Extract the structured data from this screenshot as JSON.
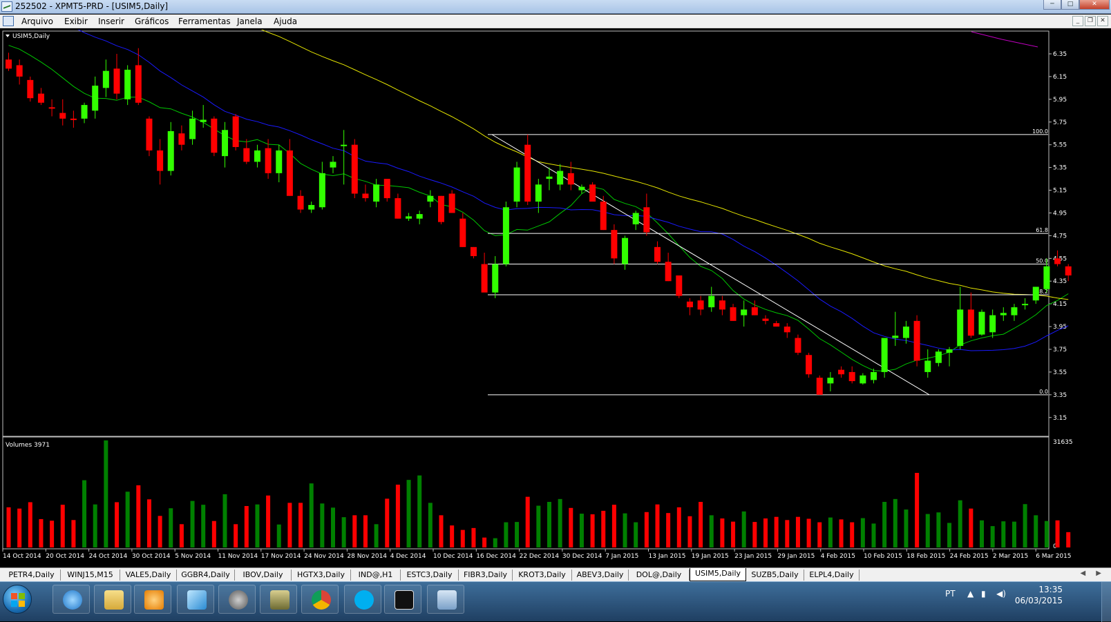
{
  "window": {
    "title": "252502 - XPMT5-PRD - [USIM5,Daily]",
    "btn_min": "─",
    "btn_max": "□",
    "btn_close": "✕"
  },
  "menu": {
    "items": [
      "Arquivo",
      "Exibir",
      "Inserir",
      "Gráficos",
      "Ferramentas",
      "Janela",
      "Ajuda"
    ],
    "mdi_min": "_",
    "mdi_restore": "❐",
    "mdi_close": "✕"
  },
  "chart": {
    "symbol_label": "USIM5,Daily",
    "volume_label": "Volumes 3971",
    "volume_max_label": "31635",
    "volume_min_label": "0",
    "price_ticks": [
      "6.35",
      "6.15",
      "5.95",
      "5.75",
      "5.55",
      "5.35",
      "5.15",
      "4.95",
      "4.75",
      "4.55",
      "4.35",
      "4.15",
      "3.95",
      "3.75",
      "3.55",
      "3.35",
      "3.15"
    ],
    "date_labels": [
      "14 Oct 2014",
      "20 Oct 2014",
      "24 Oct 2014",
      "30 Oct 2014",
      "5 Nov 2014",
      "11 Nov 2014",
      "17 Nov 2014",
      "24 Nov 2014",
      "28 Nov 2014",
      "4 Dec 2014",
      "10 Dec 2014",
      "16 Dec 2014",
      "22 Dec 2014",
      "30 Dec 2014",
      "7 Jan 2015",
      "13 Jan 2015",
      "19 Jan 2015",
      "23 Jan 2015",
      "29 Jan 2015",
      "4 Feb 2015",
      "10 Feb 2015",
      "18 Feb 2015",
      "24 Feb 2015",
      "2 Mar 2015",
      "6 Mar 2015"
    ],
    "fib_levels": [
      {
        "label": "100.0",
        "price": 5.64
      },
      {
        "label": "61.8",
        "price": 4.77
      },
      {
        "label": "50.0",
        "price": 4.5
      },
      {
        "label": "38.2",
        "price": 4.23
      },
      {
        "label": "0.0",
        "price": 3.35
      }
    ],
    "colors": {
      "bull": "#32ff00",
      "bear": "#ff0000",
      "vol_bull": "#008000",
      "vol_bear": "#ff0000",
      "ma_fast": "#00c800",
      "ma_mid": "#1a1aff",
      "ma_slow": "#e6e600",
      "ma_long": "#c000c0",
      "trend": "#ffffff"
    }
  },
  "chart_data": {
    "type": "candlestick",
    "title": "USIM5,Daily",
    "ylim": [
      3.05,
      6.45
    ],
    "candles": [
      [
        6.3,
        6.36,
        6.2,
        6.22
      ],
      [
        6.25,
        6.3,
        6.08,
        6.15
      ],
      [
        6.12,
        6.15,
        5.93,
        5.96
      ],
      [
        6.0,
        6.05,
        5.9,
        5.92
      ],
      [
        5.88,
        5.95,
        5.8,
        5.87
      ],
      [
        5.83,
        5.95,
        5.72,
        5.78
      ],
      [
        5.78,
        5.85,
        5.7,
        5.77
      ],
      [
        5.78,
        5.92,
        5.74,
        5.9
      ],
      [
        5.85,
        6.15,
        5.78,
        6.07
      ],
      [
        6.05,
        6.3,
        5.97,
        6.2
      ],
      [
        6.22,
        6.35,
        5.95,
        6.0
      ],
      [
        5.95,
        6.25,
        5.9,
        6.21
      ],
      [
        6.25,
        6.4,
        5.9,
        5.92
      ],
      [
        5.78,
        5.8,
        5.45,
        5.5
      ],
      [
        5.5,
        5.6,
        5.2,
        5.32
      ],
      [
        5.32,
        5.75,
        5.28,
        5.67
      ],
      [
        5.65,
        5.72,
        5.5,
        5.55
      ],
      [
        5.6,
        5.85,
        5.55,
        5.78
      ],
      [
        5.75,
        5.9,
        5.7,
        5.77
      ],
      [
        5.78,
        5.8,
        5.45,
        5.48
      ],
      [
        5.45,
        5.75,
        5.35,
        5.68
      ],
      [
        5.8,
        5.82,
        5.5,
        5.53
      ],
      [
        5.52,
        5.6,
        5.38,
        5.4
      ],
      [
        5.4,
        5.55,
        5.35,
        5.5
      ],
      [
        5.52,
        5.6,
        5.25,
        5.3
      ],
      [
        5.3,
        5.55,
        5.22,
        5.5
      ],
      [
        5.5,
        5.6,
        5.1,
        5.1
      ],
      [
        5.1,
        5.15,
        4.95,
        4.98
      ],
      [
        4.98,
        5.05,
        4.95,
        5.02
      ],
      [
        5.0,
        5.4,
        4.98,
        5.3
      ],
      [
        5.35,
        5.45,
        5.3,
        5.4
      ],
      [
        5.55,
        5.68,
        5.2,
        5.55
      ],
      [
        5.55,
        5.6,
        5.08,
        5.12
      ],
      [
        5.12,
        5.2,
        5.05,
        5.08
      ],
      [
        5.05,
        5.25,
        5.0,
        5.2
      ],
      [
        5.25,
        5.2,
        5.05,
        5.08
      ],
      [
        5.08,
        5.12,
        4.9,
        4.9
      ],
      [
        4.9,
        4.95,
        4.88,
        4.92
      ],
      [
        4.9,
        4.97,
        4.85,
        4.94
      ],
      [
        5.05,
        5.15,
        5.0,
        5.1
      ],
      [
        5.1,
        5.1,
        4.85,
        4.87
      ],
      [
        5.12,
        5.15,
        4.95,
        4.95
      ],
      [
        4.9,
        4.95,
        4.65,
        4.65
      ],
      [
        4.65,
        4.65,
        4.55,
        4.57
      ],
      [
        4.5,
        4.6,
        4.3,
        4.25
      ],
      [
        4.25,
        4.57,
        4.2,
        4.5
      ],
      [
        4.5,
        5.05,
        4.48,
        5.0
      ],
      [
        5.05,
        5.4,
        5.0,
        5.35
      ],
      [
        5.55,
        5.64,
        5.02,
        5.05
      ],
      [
        5.05,
        5.25,
        4.95,
        5.2
      ],
      [
        5.25,
        5.35,
        5.15,
        5.27
      ],
      [
        5.2,
        5.38,
        5.15,
        5.32
      ],
      [
        5.3,
        5.4,
        5.15,
        5.2
      ],
      [
        5.15,
        5.2,
        5.12,
        5.18
      ],
      [
        5.2,
        5.22,
        5.05,
        5.05
      ],
      [
        5.05,
        5.1,
        4.8,
        4.8
      ],
      [
        4.8,
        4.85,
        4.5,
        4.55
      ],
      [
        4.5,
        4.75,
        4.45,
        4.73
      ],
      [
        4.85,
        4.97,
        4.8,
        4.95
      ],
      [
        5.0,
        5.12,
        4.75,
        4.78
      ],
      [
        4.65,
        4.7,
        4.5,
        4.52
      ],
      [
        4.52,
        4.6,
        4.35,
        4.35
      ],
      [
        4.4,
        4.4,
        4.2,
        4.22
      ],
      [
        4.17,
        4.2,
        4.05,
        4.12
      ],
      [
        4.18,
        4.22,
        4.05,
        4.1
      ],
      [
        4.12,
        4.3,
        4.08,
        4.22
      ],
      [
        4.18,
        4.22,
        4.05,
        4.1
      ],
      [
        4.12,
        4.15,
        4.0,
        4.0
      ],
      [
        4.05,
        4.18,
        3.95,
        4.1
      ],
      [
        4.12,
        4.18,
        4.05,
        4.05
      ],
      [
        4.02,
        4.05,
        3.97,
        4.0
      ],
      [
        3.98,
        4.0,
        3.95,
        3.95
      ],
      [
        3.95,
        3.98,
        3.85,
        3.9
      ],
      [
        3.85,
        3.88,
        3.7,
        3.72
      ],
      [
        3.7,
        3.72,
        3.5,
        3.53
      ],
      [
        3.5,
        3.52,
        3.35,
        3.35
      ],
      [
        3.45,
        3.55,
        3.38,
        3.5
      ],
      [
        3.57,
        3.6,
        3.5,
        3.53
      ],
      [
        3.55,
        3.6,
        3.45,
        3.47
      ],
      [
        3.45,
        3.54,
        3.44,
        3.52
      ],
      [
        3.48,
        3.58,
        3.45,
        3.55
      ],
      [
        3.55,
        3.85,
        3.5,
        3.85
      ],
      [
        3.85,
        4.08,
        3.78,
        3.87
      ],
      [
        3.85,
        4.0,
        3.8,
        3.95
      ],
      [
        4.0,
        4.05,
        3.6,
        3.65
      ],
      [
        3.55,
        3.75,
        3.5,
        3.65
      ],
      [
        3.63,
        3.75,
        3.6,
        3.73
      ],
      [
        3.72,
        3.77,
        3.6,
        3.75
      ],
      [
        3.78,
        4.3,
        3.75,
        4.1
      ],
      [
        4.1,
        4.25,
        3.85,
        3.87
      ],
      [
        3.88,
        4.1,
        3.87,
        4.08
      ],
      [
        3.9,
        4.1,
        3.85,
        4.05
      ],
      [
        4.05,
        4.12,
        4.0,
        4.07
      ],
      [
        4.05,
        4.15,
        4.0,
        4.12
      ],
      [
        4.15,
        4.2,
        4.1,
        4.15
      ],
      [
        4.18,
        4.3,
        4.15,
        4.3
      ],
      [
        4.28,
        4.55,
        4.25,
        4.48
      ],
      [
        4.55,
        4.62,
        4.48,
        4.5
      ],
      [
        4.48,
        4.5,
        4.35,
        4.4
      ]
    ],
    "volumes": [
      12600,
      12200,
      14200,
      8900,
      8400,
      13400,
      8600,
      21100,
      13500,
      33600,
      14200,
      17500,
      19500,
      15100,
      9900,
      12300,
      7300,
      14600,
      13400,
      8300,
      16700,
      7300,
      13000,
      13500,
      16300,
      7200,
      14000,
      14000,
      20100,
      13800,
      12500,
      9500,
      10100,
      10100,
      7300,
      15300,
      19700,
      21200,
      22600,
      14000,
      10100,
      6900,
      5500,
      6100,
      3100,
      2900,
      7900,
      8000,
      15900,
      13100,
      14300,
      15200,
      12400,
      10600,
      10400,
      11500,
      13400,
      10700,
      7900,
      11100,
      13500,
      10800,
      12600,
      9800,
      14300,
      10100,
      9100,
      8100,
      11300,
      8000,
      9100,
      9600,
      8600,
      9600,
      9000,
      7900,
      9400,
      8800,
      7900,
      9200,
      7500,
      14300,
      15200,
      11900,
      23400,
      10500,
      11000,
      7700,
      14800,
      12200,
      8500,
      6700,
      8200,
      8100,
      13600,
      10100,
      8300,
      8500,
      4800
    ]
  }
}
